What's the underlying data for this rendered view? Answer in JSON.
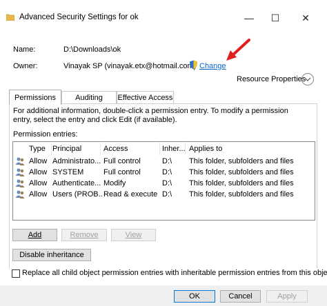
{
  "window": {
    "title": "Advanced Security Settings for ok",
    "controls": {
      "minimize": "—",
      "maximize": "☐",
      "close": "✕"
    }
  },
  "general": {
    "name_label": "Name:",
    "name_value": "D:\\Downloads\\ok",
    "owner_label": "Owner:",
    "owner_value": "Vinayak SP (vinayak.etx@hotmail.com)",
    "change_link": "Change",
    "resource_properties": "Resource Properties"
  },
  "tabs": [
    {
      "label": "Permissions",
      "active": true
    },
    {
      "label": "Auditing",
      "active": false
    },
    {
      "label": "Effective Access",
      "active": false
    }
  ],
  "permissions": {
    "info_text": "For additional information, double-click a permission entry. To modify a permission entry, select the entry and click Edit (if available).",
    "entries_label": "Permission entries:",
    "columns": [
      "Type",
      "Principal",
      "Access",
      "Inher...",
      "Applies to"
    ],
    "rows": [
      {
        "type": "Allow",
        "principal": "Administrato...",
        "access": "Full control",
        "inherited": "D:\\",
        "applies": "This folder, subfolders and files"
      },
      {
        "type": "Allow",
        "principal": "SYSTEM",
        "access": "Full control",
        "inherited": "D:\\",
        "applies": "This folder, subfolders and files"
      },
      {
        "type": "Allow",
        "principal": "Authenticate...",
        "access": "Modify",
        "inherited": "D:\\",
        "applies": "This folder, subfolders and files"
      },
      {
        "type": "Allow",
        "principal": "Users (PROB...",
        "access": "Read & execute",
        "inherited": "D:\\",
        "applies": "This folder, subfolders and files"
      }
    ],
    "add_button": "Add",
    "remove_button": "Remove",
    "view_button": "View",
    "disable_inheritance_button": "Disable inheritance",
    "replace_checkbox_label": "Replace all child object permission entries with inheritable permission entries from this object",
    "replace_checked": false
  },
  "footer": {
    "ok": "OK",
    "cancel": "Cancel",
    "apply": "Apply"
  },
  "colors": {
    "accent": "#0078d7",
    "link": "#0066cc",
    "arrow": "#e0201b",
    "disabled_text": "#a0a0a0",
    "folder": "#e8b94a"
  }
}
